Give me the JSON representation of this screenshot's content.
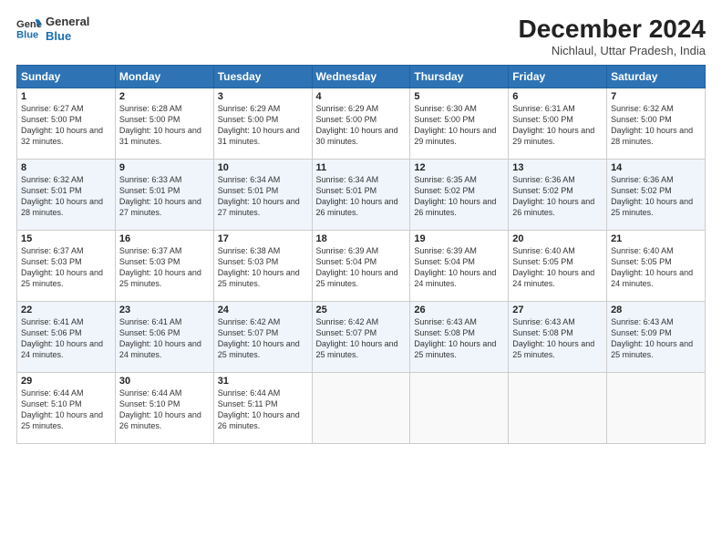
{
  "logo": {
    "line1": "General",
    "line2": "Blue"
  },
  "title": "December 2024",
  "subtitle": "Nichlaul, Uttar Pradesh, India",
  "days_of_week": [
    "Sunday",
    "Monday",
    "Tuesday",
    "Wednesday",
    "Thursday",
    "Friday",
    "Saturday"
  ],
  "weeks": [
    [
      {
        "day": "1",
        "sunrise": "Sunrise: 6:27 AM",
        "sunset": "Sunset: 5:00 PM",
        "daylight": "Daylight: 10 hours and 32 minutes."
      },
      {
        "day": "2",
        "sunrise": "Sunrise: 6:28 AM",
        "sunset": "Sunset: 5:00 PM",
        "daylight": "Daylight: 10 hours and 31 minutes."
      },
      {
        "day": "3",
        "sunrise": "Sunrise: 6:29 AM",
        "sunset": "Sunset: 5:00 PM",
        "daylight": "Daylight: 10 hours and 31 minutes."
      },
      {
        "day": "4",
        "sunrise": "Sunrise: 6:29 AM",
        "sunset": "Sunset: 5:00 PM",
        "daylight": "Daylight: 10 hours and 30 minutes."
      },
      {
        "day": "5",
        "sunrise": "Sunrise: 6:30 AM",
        "sunset": "Sunset: 5:00 PM",
        "daylight": "Daylight: 10 hours and 29 minutes."
      },
      {
        "day": "6",
        "sunrise": "Sunrise: 6:31 AM",
        "sunset": "Sunset: 5:00 PM",
        "daylight": "Daylight: 10 hours and 29 minutes."
      },
      {
        "day": "7",
        "sunrise": "Sunrise: 6:32 AM",
        "sunset": "Sunset: 5:00 PM",
        "daylight": "Daylight: 10 hours and 28 minutes."
      }
    ],
    [
      {
        "day": "8",
        "sunrise": "Sunrise: 6:32 AM",
        "sunset": "Sunset: 5:01 PM",
        "daylight": "Daylight: 10 hours and 28 minutes."
      },
      {
        "day": "9",
        "sunrise": "Sunrise: 6:33 AM",
        "sunset": "Sunset: 5:01 PM",
        "daylight": "Daylight: 10 hours and 27 minutes."
      },
      {
        "day": "10",
        "sunrise": "Sunrise: 6:34 AM",
        "sunset": "Sunset: 5:01 PM",
        "daylight": "Daylight: 10 hours and 27 minutes."
      },
      {
        "day": "11",
        "sunrise": "Sunrise: 6:34 AM",
        "sunset": "Sunset: 5:01 PM",
        "daylight": "Daylight: 10 hours and 26 minutes."
      },
      {
        "day": "12",
        "sunrise": "Sunrise: 6:35 AM",
        "sunset": "Sunset: 5:02 PM",
        "daylight": "Daylight: 10 hours and 26 minutes."
      },
      {
        "day": "13",
        "sunrise": "Sunrise: 6:36 AM",
        "sunset": "Sunset: 5:02 PM",
        "daylight": "Daylight: 10 hours and 26 minutes."
      },
      {
        "day": "14",
        "sunrise": "Sunrise: 6:36 AM",
        "sunset": "Sunset: 5:02 PM",
        "daylight": "Daylight: 10 hours and 25 minutes."
      }
    ],
    [
      {
        "day": "15",
        "sunrise": "Sunrise: 6:37 AM",
        "sunset": "Sunset: 5:03 PM",
        "daylight": "Daylight: 10 hours and 25 minutes."
      },
      {
        "day": "16",
        "sunrise": "Sunrise: 6:37 AM",
        "sunset": "Sunset: 5:03 PM",
        "daylight": "Daylight: 10 hours and 25 minutes."
      },
      {
        "day": "17",
        "sunrise": "Sunrise: 6:38 AM",
        "sunset": "Sunset: 5:03 PM",
        "daylight": "Daylight: 10 hours and 25 minutes."
      },
      {
        "day": "18",
        "sunrise": "Sunrise: 6:39 AM",
        "sunset": "Sunset: 5:04 PM",
        "daylight": "Daylight: 10 hours and 25 minutes."
      },
      {
        "day": "19",
        "sunrise": "Sunrise: 6:39 AM",
        "sunset": "Sunset: 5:04 PM",
        "daylight": "Daylight: 10 hours and 24 minutes."
      },
      {
        "day": "20",
        "sunrise": "Sunrise: 6:40 AM",
        "sunset": "Sunset: 5:05 PM",
        "daylight": "Daylight: 10 hours and 24 minutes."
      },
      {
        "day": "21",
        "sunrise": "Sunrise: 6:40 AM",
        "sunset": "Sunset: 5:05 PM",
        "daylight": "Daylight: 10 hours and 24 minutes."
      }
    ],
    [
      {
        "day": "22",
        "sunrise": "Sunrise: 6:41 AM",
        "sunset": "Sunset: 5:06 PM",
        "daylight": "Daylight: 10 hours and 24 minutes."
      },
      {
        "day": "23",
        "sunrise": "Sunrise: 6:41 AM",
        "sunset": "Sunset: 5:06 PM",
        "daylight": "Daylight: 10 hours and 24 minutes."
      },
      {
        "day": "24",
        "sunrise": "Sunrise: 6:42 AM",
        "sunset": "Sunset: 5:07 PM",
        "daylight": "Daylight: 10 hours and 25 minutes."
      },
      {
        "day": "25",
        "sunrise": "Sunrise: 6:42 AM",
        "sunset": "Sunset: 5:07 PM",
        "daylight": "Daylight: 10 hours and 25 minutes."
      },
      {
        "day": "26",
        "sunrise": "Sunrise: 6:43 AM",
        "sunset": "Sunset: 5:08 PM",
        "daylight": "Daylight: 10 hours and 25 minutes."
      },
      {
        "day": "27",
        "sunrise": "Sunrise: 6:43 AM",
        "sunset": "Sunset: 5:08 PM",
        "daylight": "Daylight: 10 hours and 25 minutes."
      },
      {
        "day": "28",
        "sunrise": "Sunrise: 6:43 AM",
        "sunset": "Sunset: 5:09 PM",
        "daylight": "Daylight: 10 hours and 25 minutes."
      }
    ],
    [
      {
        "day": "29",
        "sunrise": "Sunrise: 6:44 AM",
        "sunset": "Sunset: 5:10 PM",
        "daylight": "Daylight: 10 hours and 25 minutes."
      },
      {
        "day": "30",
        "sunrise": "Sunrise: 6:44 AM",
        "sunset": "Sunset: 5:10 PM",
        "daylight": "Daylight: 10 hours and 26 minutes."
      },
      {
        "day": "31",
        "sunrise": "Sunrise: 6:44 AM",
        "sunset": "Sunset: 5:11 PM",
        "daylight": "Daylight: 10 hours and 26 minutes."
      },
      null,
      null,
      null,
      null
    ]
  ]
}
